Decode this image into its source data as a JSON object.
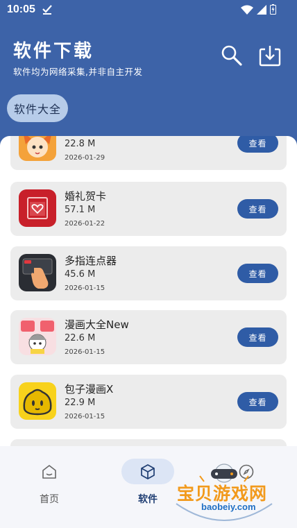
{
  "status_bar": {
    "time": "10:05"
  },
  "header": {
    "title": "软件下载",
    "subtitle": "软件均为网络采集,并非自主开发",
    "search_icon": "search-icon",
    "download_icon": "download-icon"
  },
  "filter_chip": {
    "label": "软件大全"
  },
  "apps": [
    {
      "name": "",
      "size": "22.8 M",
      "date": "2026-01-29",
      "action": "查看"
    },
    {
      "name": "婚礼贺卡",
      "size": "57.1 M",
      "date": "2026-01-22",
      "action": "查看"
    },
    {
      "name": "多指连点器",
      "size": "45.6 M",
      "date": "2026-01-15",
      "action": "查看"
    },
    {
      "name": "漫画大全New",
      "size": "22.6 M",
      "date": "2026-01-15",
      "action": "查看"
    },
    {
      "name": "包子漫画X",
      "size": "22.9 M",
      "date": "2026-01-15",
      "action": "查看"
    }
  ],
  "bottom_nav": {
    "items": [
      {
        "label": "首页",
        "icon": "home-icon",
        "active": false
      },
      {
        "label": "软件",
        "icon": "cube-icon",
        "active": true
      },
      {
        "label": "",
        "icon": "compass-icon",
        "active": false
      }
    ]
  },
  "watermark": {
    "text": "宝贝游戏网",
    "url": "baobeiy.com"
  },
  "colors": {
    "header": "#3d63a8",
    "button": "#2f5ca6",
    "chip": "#b7cce9",
    "card": "#ececec"
  }
}
